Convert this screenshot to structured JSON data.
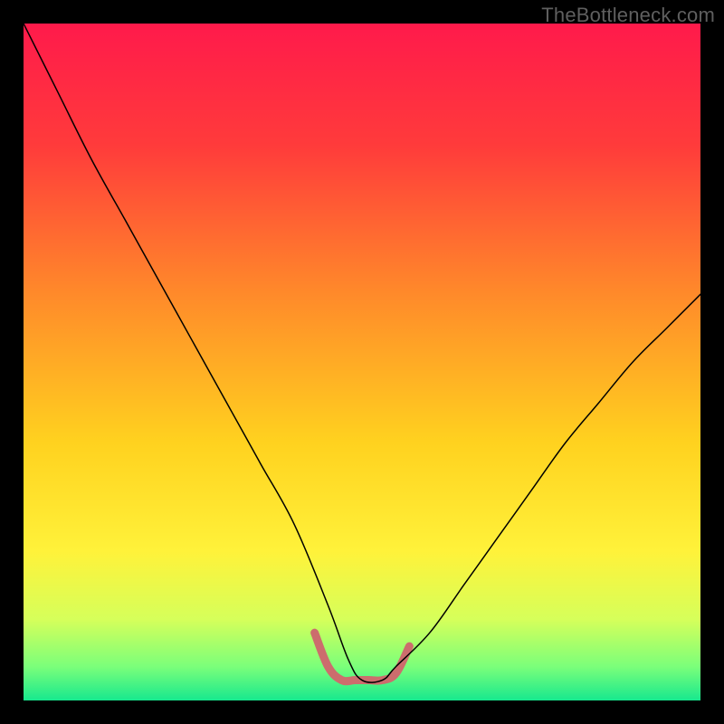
{
  "attribution": "TheBottleneck.com",
  "chart_data": {
    "type": "line",
    "title": "",
    "xlabel": "",
    "ylabel": "",
    "xlim": [
      0,
      100
    ],
    "ylim": [
      0,
      100
    ],
    "background": {
      "type": "vertical-gradient",
      "stops": [
        {
          "offset": 0,
          "color": "#ff1a4b"
        },
        {
          "offset": 18,
          "color": "#ff3b3b"
        },
        {
          "offset": 40,
          "color": "#ff8a2a"
        },
        {
          "offset": 62,
          "color": "#ffd21f"
        },
        {
          "offset": 78,
          "color": "#fff23a"
        },
        {
          "offset": 88,
          "color": "#d6ff5a"
        },
        {
          "offset": 95,
          "color": "#7bff7a"
        },
        {
          "offset": 100,
          "color": "#17e88e"
        }
      ]
    },
    "series": [
      {
        "name": "bottleneck-curve",
        "color": "#000000",
        "stroke_width": 1.5,
        "x": [
          0,
          5,
          10,
          15,
          20,
          25,
          30,
          35,
          40,
          45,
          48,
          50,
          53,
          55,
          60,
          65,
          70,
          75,
          80,
          85,
          90,
          95,
          100
        ],
        "values": [
          100,
          90,
          80,
          71,
          62,
          53,
          44,
          35,
          26,
          14,
          6,
          3,
          3,
          5,
          10,
          17,
          24,
          31,
          38,
          44,
          50,
          55,
          60
        ]
      }
    ],
    "overlay": {
      "name": "optimal-zone-marker",
      "color": "#cc6d6d",
      "stroke_width": 9,
      "x": [
        43,
        45,
        47,
        49,
        51,
        53,
        55,
        57
      ],
      "values": [
        10,
        5,
        3,
        3,
        3,
        3,
        4,
        8
      ]
    }
  }
}
